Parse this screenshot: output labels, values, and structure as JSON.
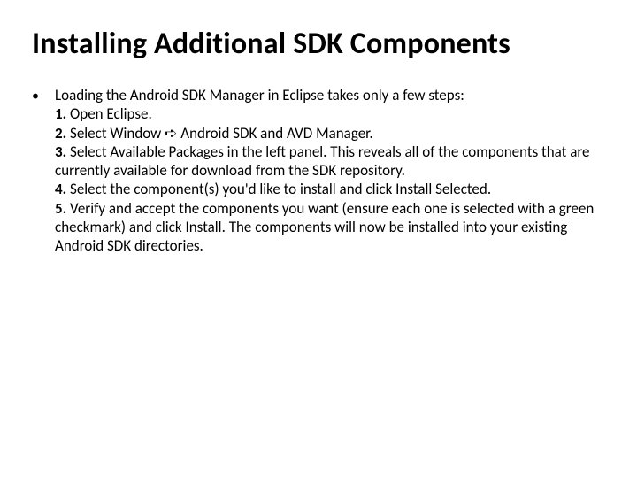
{
  "title": "Installing Additional SDK Components",
  "bullet_symbol": "•",
  "intro": "Loading the Android SDK Manager in Eclipse takes only a few steps:",
  "steps": {
    "n1": "1.",
    "t1": " Open Eclipse.",
    "n2": "2.",
    "t2": " Select Window ➪ Android SDK and AVD Manager.",
    "n3": "3.",
    "t3": " Select Available Packages in the left panel. This reveals all of the components that are currently available for download from the SDK repository.",
    "n4": "4.",
    "t4": " Select the component(s) you'd like to install and click Install Selected.",
    "n5": "5.",
    "t5": " Verify and accept the components you want (ensure each one is selected with a green checkmark) and click Install. The components will now be installed into your existing Android SDK directories."
  }
}
